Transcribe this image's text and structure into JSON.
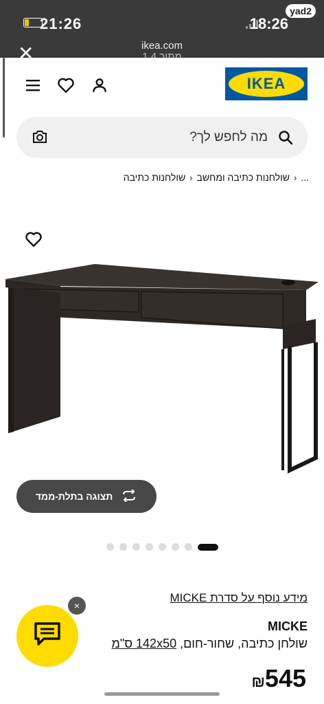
{
  "status_bar": {
    "time_left": "21:26",
    "time_right": "18:26",
    "yad2_label": "yad2",
    "url": "ikea.com",
    "page_count": "1 מתוך 4"
  },
  "header": {
    "logo_text": "IKEA"
  },
  "search": {
    "placeholder": "מה לחפש לך?"
  },
  "breadcrumb": {
    "items": [
      "...",
      "שולחנות כתיבה ומחשב",
      "שולחנות כתיבה"
    ]
  },
  "product": {
    "view_3d_label": "תצוגה בתלת-ממד",
    "more_info_link": "מידע נוסף על סדרת MICKE",
    "name": "MICKE",
    "description_prefix": "שולחן כתיבה, שחור-חום, ",
    "size": "142x50 ס\"מ",
    "price": "545",
    "currency": "₪"
  },
  "carousel": {
    "total": 8,
    "active_index": 7
  },
  "chat": {
    "close_label": "×"
  },
  "colors": {
    "ikea_blue": "#0058a3",
    "ikea_yellow": "#ffdb00",
    "desk": "#2e2925"
  }
}
